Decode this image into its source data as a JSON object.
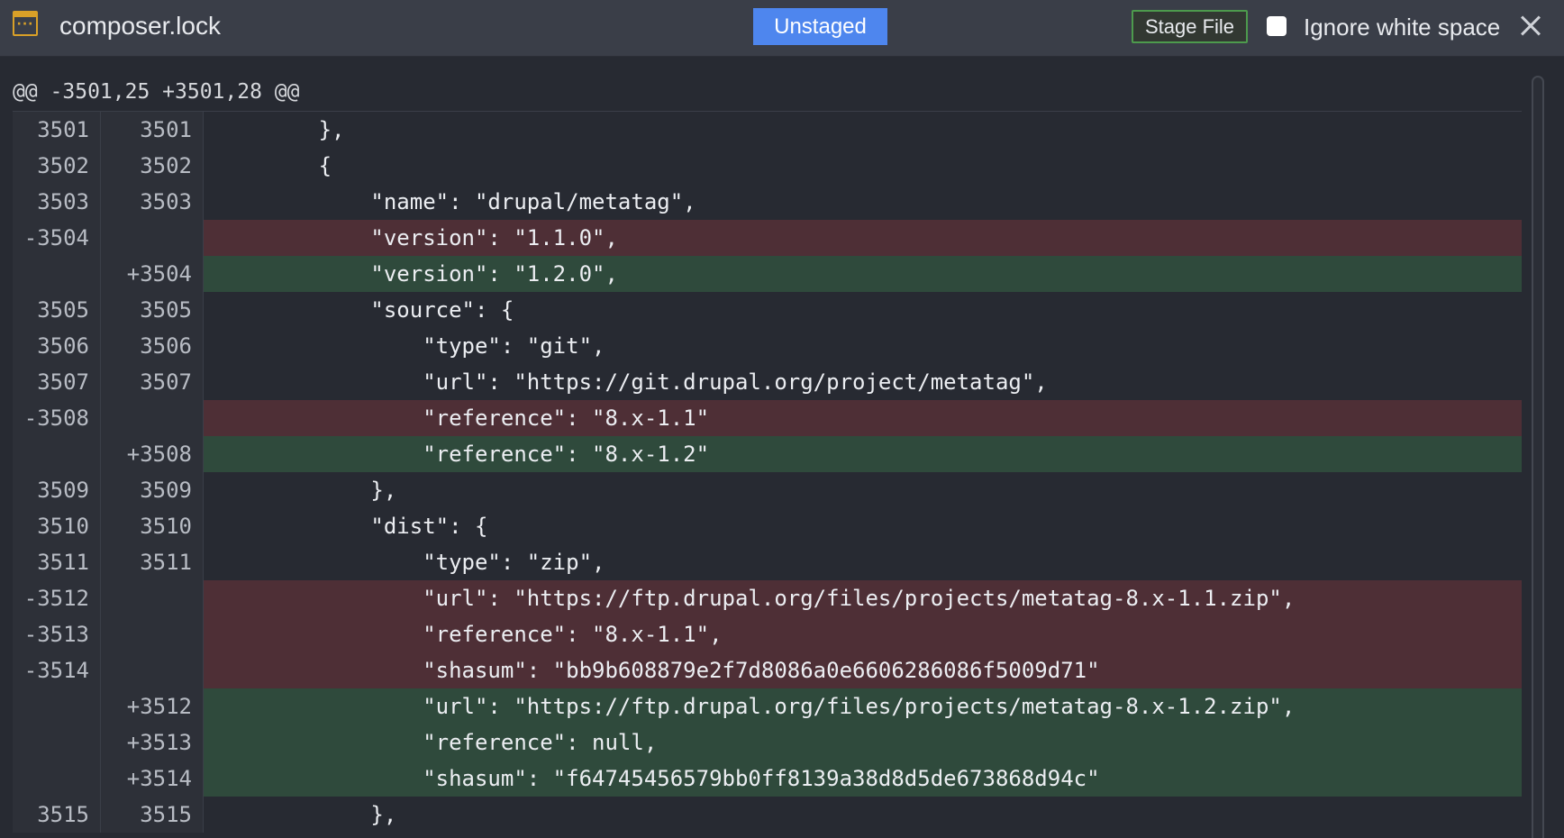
{
  "header": {
    "filename": "composer.lock",
    "file_icon": "file-options-icon",
    "status": "Unstaged",
    "stage_button": "Stage File",
    "ignore_ws_label": "Ignore white space",
    "close_icon": "close-icon"
  },
  "colors": {
    "accent": "#4e86ee",
    "stage_border": "#4d9a4d",
    "icon": "#d9a028",
    "deleted_bg": "#4e2f36",
    "added_bg": "#2f4a3c"
  },
  "hunk_header": "@@ -3501,25 +3501,28 @@",
  "lines": [
    {
      "type": "ctx",
      "old": "3501",
      "new": "3501",
      "text": "        },"
    },
    {
      "type": "ctx",
      "old": "3502",
      "new": "3502",
      "text": "        {"
    },
    {
      "type": "ctx",
      "old": "3503",
      "new": "3503",
      "text": "            \"name\": \"drupal/metatag\","
    },
    {
      "type": "del",
      "old": "-3504",
      "new": "",
      "text": "            \"version\": \"1.1.0\","
    },
    {
      "type": "add",
      "old": "",
      "new": "+3504",
      "text": "            \"version\": \"1.2.0\","
    },
    {
      "type": "ctx",
      "old": "3505",
      "new": "3505",
      "text": "            \"source\": {"
    },
    {
      "type": "ctx",
      "old": "3506",
      "new": "3506",
      "text": "                \"type\": \"git\","
    },
    {
      "type": "ctx",
      "old": "3507",
      "new": "3507",
      "text": "                \"url\": \"https://git.drupal.org/project/metatag\","
    },
    {
      "type": "del",
      "old": "-3508",
      "new": "",
      "text": "                \"reference\": \"8.x-1.1\""
    },
    {
      "type": "add",
      "old": "",
      "new": "+3508",
      "text": "                \"reference\": \"8.x-1.2\""
    },
    {
      "type": "ctx",
      "old": "3509",
      "new": "3509",
      "text": "            },"
    },
    {
      "type": "ctx",
      "old": "3510",
      "new": "3510",
      "text": "            \"dist\": {"
    },
    {
      "type": "ctx",
      "old": "3511",
      "new": "3511",
      "text": "                \"type\": \"zip\","
    },
    {
      "type": "del",
      "old": "-3512",
      "new": "",
      "text": "                \"url\": \"https://ftp.drupal.org/files/projects/metatag-8.x-1.1.zip\","
    },
    {
      "type": "del",
      "old": "-3513",
      "new": "",
      "text": "                \"reference\": \"8.x-1.1\","
    },
    {
      "type": "del",
      "old": "-3514",
      "new": "",
      "text": "                \"shasum\": \"bb9b608879e2f7d8086a0e6606286086f5009d71\""
    },
    {
      "type": "add",
      "old": "",
      "new": "+3512",
      "text": "                \"url\": \"https://ftp.drupal.org/files/projects/metatag-8.x-1.2.zip\","
    },
    {
      "type": "add",
      "old": "",
      "new": "+3513",
      "text": "                \"reference\": null,"
    },
    {
      "type": "add",
      "old": "",
      "new": "+3514",
      "text": "                \"shasum\": \"f64745456579bb0ff8139a38d8d5de673868d94c\""
    },
    {
      "type": "ctx",
      "old": "3515",
      "new": "3515",
      "text": "            },"
    }
  ]
}
